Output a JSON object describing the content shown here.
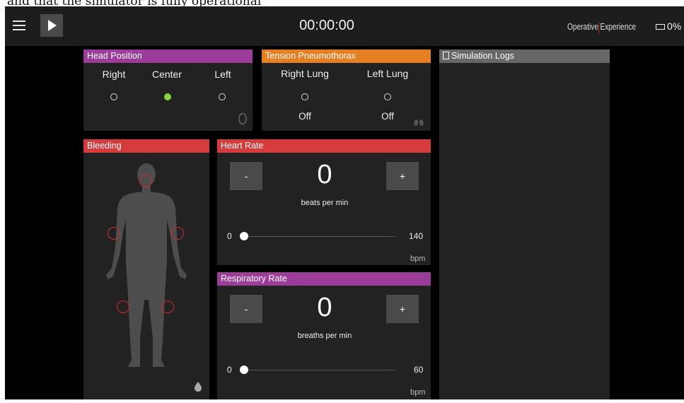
{
  "caption": "and that the simulator is fully operational",
  "topbar": {
    "timer": "00:00:00",
    "brand_left": "Operative",
    "brand_right": "Experience",
    "battery": "0%"
  },
  "head_position": {
    "title": "Head Position",
    "options": [
      "Right",
      "Center",
      "Left"
    ],
    "selected": "Center"
  },
  "tension_pneumothorax": {
    "title": "Tension Pneumothorax",
    "columns": [
      {
        "label": "Right Lung",
        "state": "Off"
      },
      {
        "label": "Left Lung",
        "state": "Off"
      }
    ]
  },
  "simulation_logs": {
    "title": "Simulation Logs"
  },
  "bleeding": {
    "title": "Bleeding"
  },
  "heart_rate": {
    "title": "Heart Rate",
    "minus": "-",
    "plus": "+",
    "value": "0",
    "unit_label": "beats per min",
    "slider_min": "0",
    "slider_max": "140",
    "slider_value": 0,
    "unit_short": "bpm"
  },
  "respiratory_rate": {
    "title": "Respiratory Rate",
    "minus": "-",
    "plus": "+",
    "value": "0",
    "unit_label": "breaths per min",
    "slider_min": "0",
    "slider_max": "60",
    "slider_value": 0,
    "unit_short": "bpm"
  },
  "colors": {
    "purple": "#9b3d98",
    "orange": "#e67e22",
    "red": "#d63b3b",
    "selected_green": "#8ad342"
  }
}
